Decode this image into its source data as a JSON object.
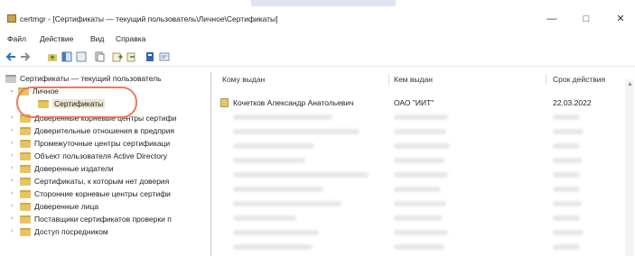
{
  "window": {
    "title": "certmgr - [Сертификаты — текущий пользователь\\Личное\\Сертификаты]",
    "controls": [
      "—",
      "□",
      "✕"
    ]
  },
  "menu": [
    "Файл",
    "Действие",
    "Вид",
    "Справка"
  ],
  "tree": {
    "root": "Сертификаты — текущий пользователь",
    "personal": "Личное",
    "personal_certs": "Сертификаты",
    "items": [
      "Доверенные корневые центры сертифи",
      "Доверительные отношения в предприя",
      "Промежуточные центры сертификаци",
      "Объект пользователя Active Directory",
      "Доверенные издатели",
      "Сертификаты, к которым нет доверия",
      "Сторонние корневые центры сертифи",
      "Доверенные лица",
      "Поставщики сертификатов проверки п",
      "Доступ посредником"
    ]
  },
  "list": {
    "columns": [
      "Кому выдан",
      "Кем выдан",
      "Срок действия"
    ],
    "rows": [
      {
        "issued_to": "Кочетков Александр Анатольевич",
        "issued_by": "ОАО \"ИИТ\"",
        "expires": "22.03.2022"
      }
    ]
  }
}
